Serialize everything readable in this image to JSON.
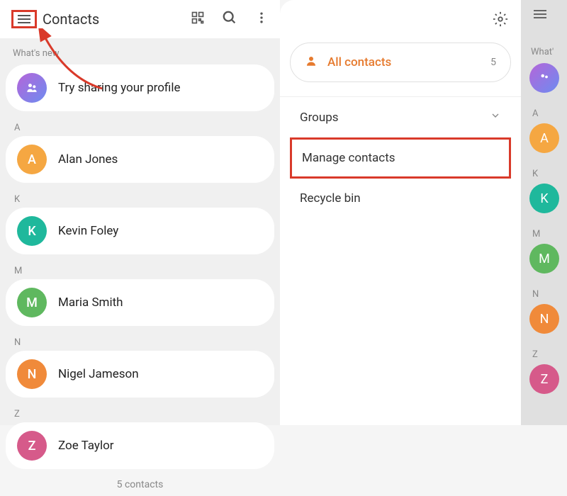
{
  "left": {
    "title": "Contacts",
    "whats_new": "What's new",
    "profile_row": "Try sharing your profile",
    "sections": [
      {
        "letter": "A",
        "name": "Alan Jones",
        "initial": "A",
        "color": "avatar-orange"
      },
      {
        "letter": "K",
        "name": "Kevin Foley",
        "initial": "K",
        "color": "avatar-teal"
      },
      {
        "letter": "M",
        "name": "Maria Smith",
        "initial": "M",
        "color": "avatar-green"
      },
      {
        "letter": "N",
        "name": "Nigel Jameson",
        "initial": "N",
        "color": "avatar-orange2"
      },
      {
        "letter": "Z",
        "name": "Zoe Taylor",
        "initial": "Z",
        "color": "avatar-pink"
      }
    ],
    "footer": "5 contacts"
  },
  "middle": {
    "all_contacts": "All contacts",
    "all_count": "5",
    "groups": "Groups",
    "manage": "Manage contacts",
    "recycle": "Recycle bin"
  },
  "right": {
    "whats_new": "What'",
    "letters": [
      "A",
      "K",
      "M",
      "N",
      "Z"
    ],
    "colors": [
      "avatar-orange",
      "avatar-teal",
      "avatar-green",
      "avatar-orange2",
      "avatar-pink"
    ],
    "initials": [
      "A",
      "K",
      "M",
      "N",
      "Z"
    ]
  }
}
